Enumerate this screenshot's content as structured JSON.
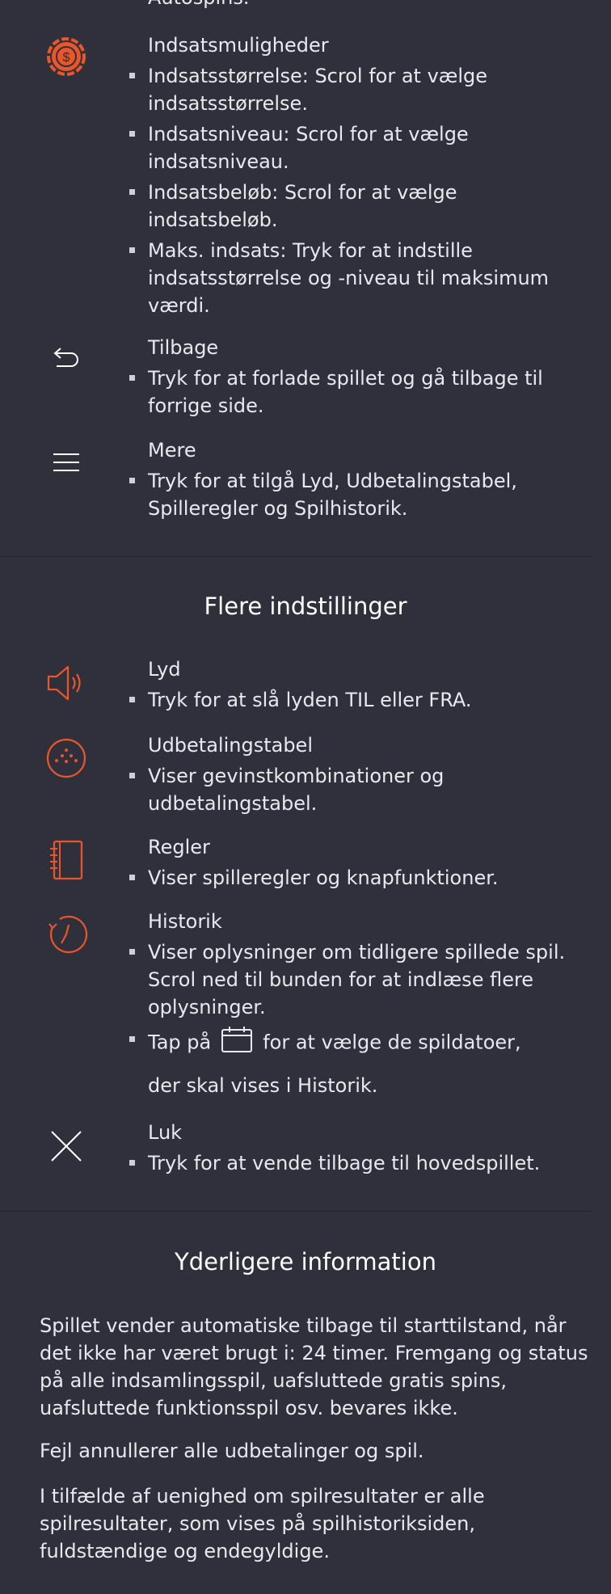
{
  "top_cut_text": "Autospins.",
  "bet_options": {
    "title": "Indsatsmuligheder",
    "icon": "dollar-chip-icon",
    "bullets": [
      "Indsatsstørrelse: Scrol for at vælge indsatsstørrelse.",
      "Indsatsniveau: Scrol for at vælge indsatsniveau.",
      "Indsatsbeløb: Scrol for at vælge indsatsbeløb.",
      "Maks. indsats: Tryk for at indstille indsatsstørrelse og -niveau til maksimum værdi."
    ]
  },
  "back": {
    "title": "Tilbage",
    "icon": "back-arrow-icon",
    "bullets": [
      "Tryk for at forlade spillet og gå tilbage til forrige side."
    ]
  },
  "more": {
    "title": "Mere",
    "icon": "hamburger-menu-icon",
    "bullets": [
      "Tryk for at tilgå Lyd, Udbetalingstabel, Spilleregler og Spilhistorik."
    ]
  },
  "settings": {
    "heading": "Flere indstillinger",
    "sound": {
      "title": "Lyd",
      "icon": "speaker-icon",
      "bullets": [
        "Tryk for at slå lyden TIL eller FRA."
      ]
    },
    "paytable": {
      "title": "Udbetalingstabel",
      "icon": "paytable-dice-icon",
      "bullets": [
        "Viser gevinstkombinationer og udbetalingstabel."
      ]
    },
    "rules": {
      "title": "Regler",
      "icon": "rules-notebook-icon",
      "bullets": [
        "Viser spilleregler og knapfunktioner."
      ]
    },
    "history": {
      "title": "Historik",
      "icon": "history-clock-icon",
      "bullets": [
        "Viser oplysninger om tidligere spillede spil. Scrol ned til bunden for at indlæse flere oplysninger."
      ],
      "tap_prefix": "Tap på",
      "tap_suffix": "for at vælge de spildatoer,",
      "tap_line2": "der skal vises i Historik.",
      "calendar_icon": "calendar-icon"
    },
    "close": {
      "title": "Luk",
      "icon": "close-icon",
      "bullets": [
        "Tryk for at vende tilbage til hovedspillet."
      ]
    }
  },
  "additional": {
    "heading": "Yderligere information",
    "paragraphs": [
      "Spillet vender automatiske tilbage til starttilstand, når det ikke har været brugt i: 24 timer. Fremgang og status på alle indsamlingsspil, uafsluttede gratis spins, uafsluttede funktionsspil osv. bevares ikke.",
      "Fejl annullerer alle udbetalinger og spil.",
      "I tilfælde af uenighed om spilresultater er alle spilresultater, som vises på spilhistoriksiden, fuldstændige og endegyldige."
    ]
  },
  "colors": {
    "background": "#30303c",
    "accent": "#e8562a",
    "text": "#e8e8ee"
  }
}
